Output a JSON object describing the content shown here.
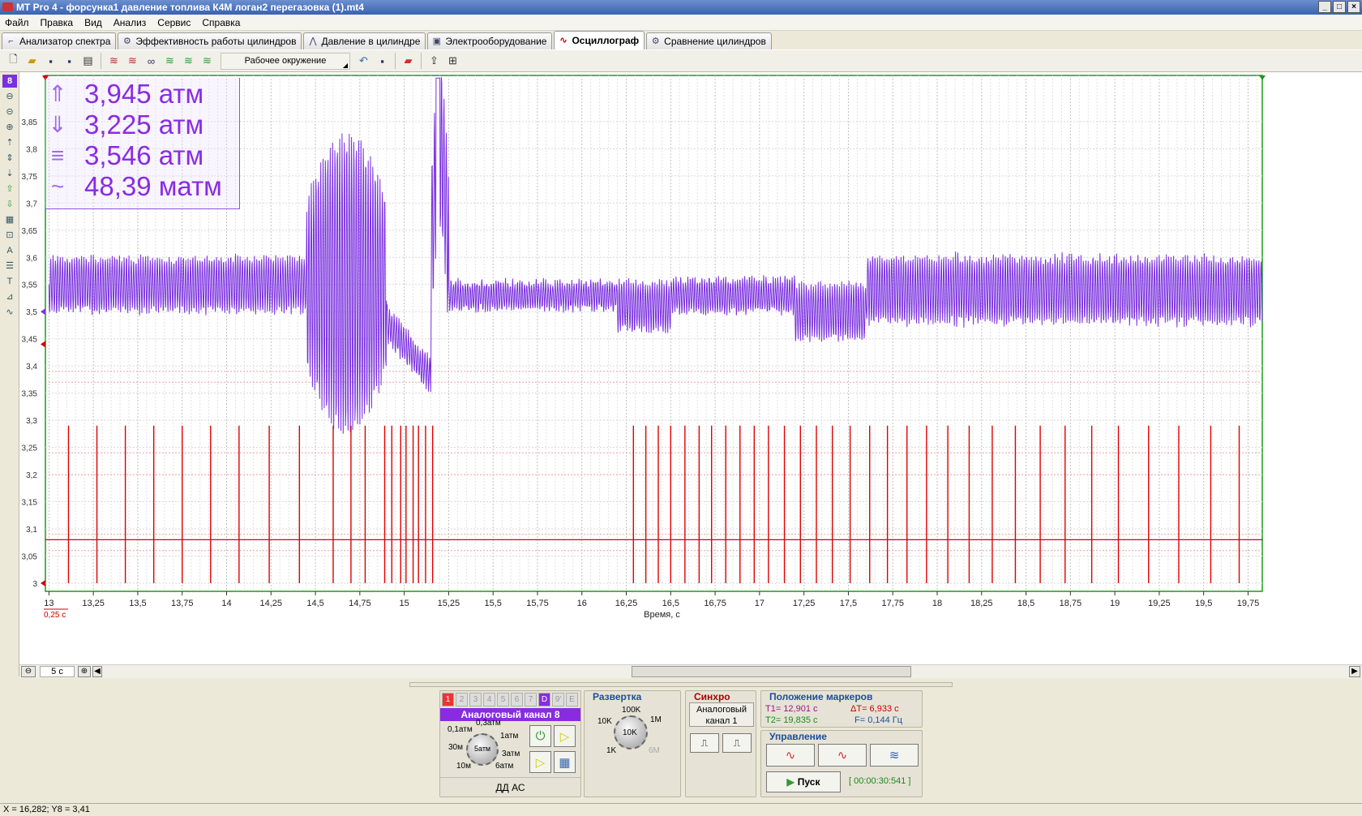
{
  "window": {
    "title": "MT Pro 4 - форсунка1 давление топлива К4М логан2 перегазовка (1).mt4"
  },
  "menu": [
    "Файл",
    "Правка",
    "Вид",
    "Анализ",
    "Сервис",
    "Справка"
  ],
  "tabs": [
    {
      "label": "Анализатор спектра",
      "icon": "spectrum-icon"
    },
    {
      "label": "Эффективность работы цилиндров",
      "icon": "gear-icon"
    },
    {
      "label": "Давление в цилиндре",
      "icon": "pressure-icon"
    },
    {
      "label": "Электрооборудование",
      "icon": "electric-icon"
    },
    {
      "label": "Осциллограф",
      "icon": "wave-icon",
      "active": true
    },
    {
      "label": "Сравнение цилиндров",
      "icon": "compare-icon"
    }
  ],
  "toolbar": {
    "workspace_label": "Рабочее окружение"
  },
  "readout": {
    "max": "3,945 атм",
    "min": "3,225 атм",
    "avg": "3,546 атм",
    "ripple": "48,39 матм"
  },
  "chart_data": {
    "type": "line",
    "xlabel": "Время, с",
    "xlim": [
      12.98,
      19.83
    ],
    "ylim": [
      2.985,
      3.935
    ],
    "x_ticks": [
      "13",
      "13,25",
      "13,5",
      "13,75",
      "14",
      "14,25",
      "14,5",
      "14,75",
      "15",
      "15,25",
      "15,5",
      "15,75",
      "16",
      "16,25",
      "16,5",
      "16,75",
      "17",
      "17,25",
      "17,5",
      "17,75",
      "18",
      "18,25",
      "18,5",
      "18,75",
      "19",
      "19,25",
      "19,5",
      "19,75"
    ],
    "y_ticks": [
      "3",
      "3,05",
      "3,1",
      "3,15",
      "3,2",
      "3,25",
      "3,3",
      "3,35",
      "3,4",
      "3,45",
      "3,5",
      "3,55",
      "3,6",
      "3,65",
      "3,7",
      "3,75",
      "3,8",
      "3,85"
    ],
    "series": [
      {
        "channel": "8",
        "color": "#7a2fe0",
        "base": 3.55,
        "ripple": 0.05,
        "kind": "pressure"
      },
      {
        "channel": "1",
        "color": "#e00000",
        "base": 3.08,
        "kind": "injector-pulses",
        "pulses": [
          13.11,
          13.27,
          13.43,
          13.59,
          13.75,
          13.91,
          14.07,
          14.24,
          14.41,
          14.6,
          14.7,
          14.78,
          14.89,
          14.93,
          14.98,
          15.01,
          15.05,
          15.08,
          15.12,
          15.16,
          16.29,
          16.36,
          16.43,
          16.5,
          16.58,
          16.66,
          16.73,
          16.81,
          16.89,
          16.97,
          17.05,
          17.14,
          17.23,
          17.32,
          17.41,
          17.51,
          17.62,
          17.72,
          17.83,
          17.94,
          18.06,
          18.18,
          18.31,
          18.44,
          18.58,
          18.72,
          18.87,
          19.02,
          19.19,
          19.36,
          19.54,
          19.7
        ]
      }
    ],
    "x_scale_label": "0,25 с"
  },
  "scrollbar": {
    "zoom": "5 с"
  },
  "channels": {
    "buttons": [
      "1",
      "2",
      "3",
      "4",
      "5",
      "6",
      "7",
      "D",
      "9'",
      "E"
    ],
    "title": "Аналоговый канал 8",
    "ranges": [
      "0,1атм",
      "0,3атм",
      "1атм",
      "3атм",
      "6атм",
      "30м",
      "10м",
      "5атм"
    ],
    "sensor": "ДД АС"
  },
  "sweep": {
    "title": "Развертка",
    "labels": [
      "100K",
      "1M",
      "10K",
      "1K",
      "6M",
      "10K"
    ]
  },
  "sync": {
    "title": "Синхро",
    "source": "Аналоговый канал 1"
  },
  "markers": {
    "title": "Положение маркеров",
    "t1": "T1= 12,901 с",
    "dt": "ΔT= 6,933 с",
    "t2": "T2= 19,835 с",
    "f": "F= 0,144 Гц"
  },
  "control": {
    "title": "Управление",
    "start": "Пуск",
    "timer": "[ 00:00:30:541 ]"
  },
  "status": {
    "text": "X = 16,282; Y8 = 3,41"
  }
}
